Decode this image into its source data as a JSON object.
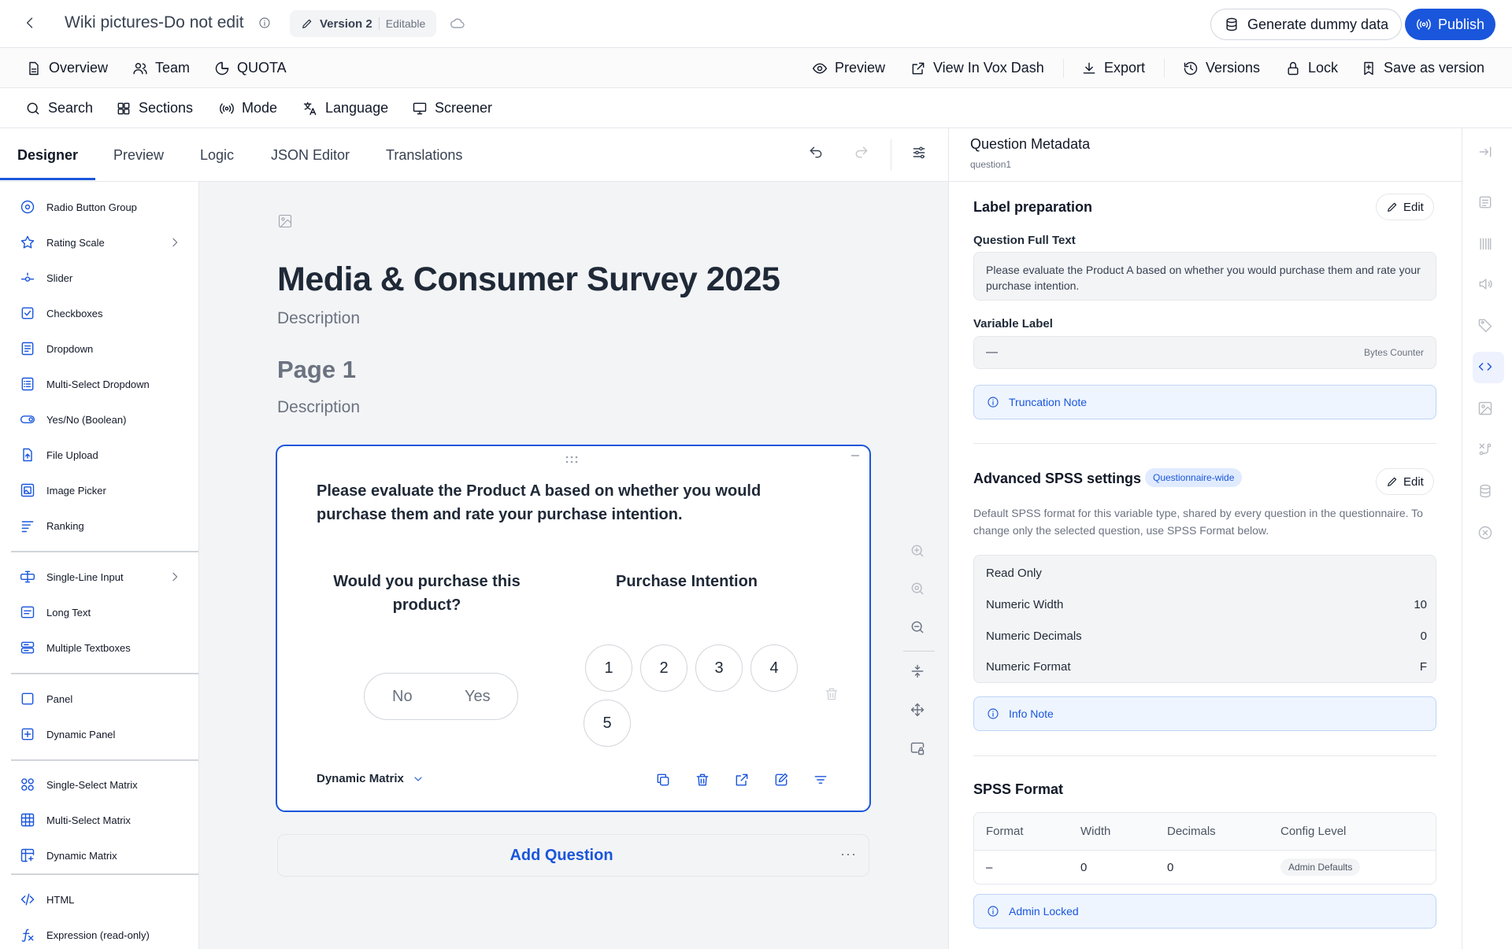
{
  "topbar": {
    "title": "Wiki pictures-Do not edit",
    "version_label": "Version 2",
    "version_state": "Editable",
    "generate_label": "Generate dummy data",
    "publish_label": "Publish"
  },
  "nav": {
    "overview": "Overview",
    "team": "Team",
    "quota": "QUOTA",
    "preview": "Preview",
    "view_in_vox": "View In Vox Dash",
    "export": "Export",
    "versions": "Versions",
    "lock": "Lock",
    "save_as_version": "Save as version"
  },
  "toolbar": {
    "search": "Search",
    "sections": "Sections",
    "mode": "Mode",
    "language": "Language",
    "screener": "Screener"
  },
  "tabs": [
    "Designer",
    "Preview",
    "Logic",
    "JSON Editor",
    "Translations"
  ],
  "toolbox": {
    "items": [
      {
        "label": "Radio Button Group",
        "icon": "radio-icon"
      },
      {
        "label": "Rating Scale",
        "icon": "star-icon"
      },
      {
        "label": "Slider",
        "icon": "slider-icon"
      },
      {
        "label": "Checkboxes",
        "icon": "checkbox-icon"
      },
      {
        "label": "Dropdown",
        "icon": "dropdown-icon"
      },
      {
        "label": "Multi-Select Dropdown",
        "icon": "multi-dropdown-icon"
      },
      {
        "label": "Yes/No (Boolean)",
        "icon": "toggle-icon"
      },
      {
        "label": "File Upload",
        "icon": "file-upload-icon"
      },
      {
        "label": "Image Picker",
        "icon": "image-picker-icon"
      },
      {
        "label": "Ranking",
        "icon": "ranking-icon"
      },
      {
        "label": "Single-Line Input",
        "icon": "text-cursor-icon"
      },
      {
        "label": "Long Text",
        "icon": "long-text-icon"
      },
      {
        "label": "Multiple Textboxes",
        "icon": "multi-textbox-icon"
      },
      {
        "label": "Panel",
        "icon": "panel-icon"
      },
      {
        "label": "Dynamic Panel",
        "icon": "dynamic-panel-icon"
      },
      {
        "label": "Single-Select Matrix",
        "icon": "single-matrix-icon"
      },
      {
        "label": "Multi-Select Matrix",
        "icon": "multi-matrix-icon"
      },
      {
        "label": "Dynamic Matrix",
        "icon": "dynamic-matrix-icon"
      },
      {
        "label": "HTML",
        "icon": "code-icon"
      },
      {
        "label": "Expression (read-only)",
        "icon": "function-icon"
      }
    ]
  },
  "survey": {
    "title": "Media & Consumer Survey 2025",
    "description": "Description",
    "page_title": "Page 1",
    "page_description": "Description"
  },
  "question": {
    "text": "Please evaluate the Product A based on whether you would purchase them and rate your purchase intention.",
    "col1_header": "Would you purchase this product?",
    "col2_header": "Purchase Intention",
    "bool_no": "No",
    "bool_yes": "Yes",
    "rating_values": [
      "1",
      "2",
      "3",
      "4",
      "5"
    ],
    "type_label": "Dynamic Matrix"
  },
  "add_question": {
    "label": "Add Question",
    "more": "···"
  },
  "meta": {
    "title": "Question Metadata",
    "subtitle": "question1",
    "label_prep": {
      "title": "Label preparation",
      "edit": "Edit",
      "full_text_label": "Question Full Text",
      "full_text": "Please evaluate the Product A based on whether you would purchase them and rate your purchase intention.",
      "variable_label": "Variable Label",
      "variable_value": "—",
      "bytes_counter": "Bytes Counter",
      "truncation_note": "Truncation Note"
    },
    "spss_adv": {
      "title": "Advanced SPSS settings",
      "badge": "Questionnaire-wide",
      "edit": "Edit",
      "description": "Default SPSS format for this variable type, shared by every question in the questionnaire. To change only the selected question, use SPSS Format below.",
      "read_only": "Read Only",
      "rows": [
        {
          "key": "Numeric Width",
          "value": "10"
        },
        {
          "key": "Numeric Decimals",
          "value": "0"
        },
        {
          "key": "Numeric Format",
          "value": "F"
        }
      ],
      "info_note": "Info Note"
    },
    "spss_format": {
      "title": "SPSS Format",
      "headers": [
        "Format",
        "Width",
        "Decimals",
        "Config Level"
      ],
      "row": {
        "format": "–",
        "width": "0",
        "decimals": "0",
        "config_level": "Admin Defaults"
      },
      "admin_locked": "Admin Locked"
    }
  },
  "colors": {
    "accent": "#1a56db",
    "canvas_bg": "#f3f4f6",
    "note_bg": "#eef5ff"
  }
}
